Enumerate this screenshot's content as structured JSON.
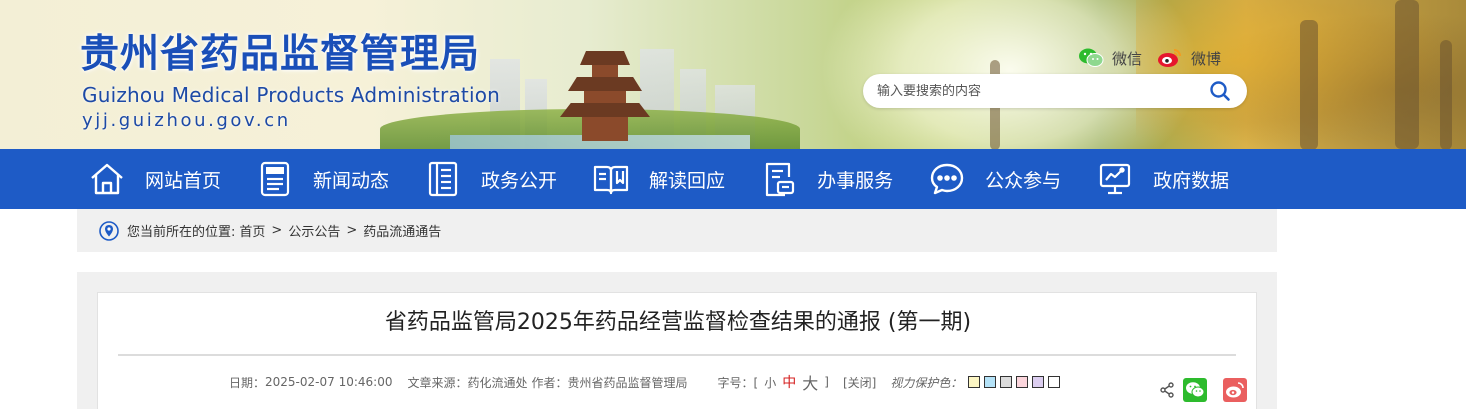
{
  "header": {
    "title": "贵州省药品监督管理局",
    "subtitle_en": "Guizhou Medical Products Administration",
    "domain": "yjj.guizhou.gov.cn",
    "wechat_label": "微信",
    "weibo_label": "微博",
    "search_placeholder": "输入要搜索的内容",
    "search_value": ""
  },
  "nav": {
    "items": [
      {
        "label": "网站首页",
        "icon": "home-icon"
      },
      {
        "label": "新闻动态",
        "icon": "news-icon"
      },
      {
        "label": "政务公开",
        "icon": "document-list-icon"
      },
      {
        "label": "解读回应",
        "icon": "open-book-icon"
      },
      {
        "label": "办事服务",
        "icon": "service-form-icon"
      },
      {
        "label": "公众参与",
        "icon": "chat-bubble-icon"
      },
      {
        "label": "政府数据",
        "icon": "data-monitor-icon"
      }
    ]
  },
  "breadcrumb": {
    "prefix": "您当前所在的位置:",
    "items": [
      "首页",
      "公示公告",
      "药品流通通告"
    ],
    "separator": ">"
  },
  "article": {
    "title": "省药品监管局2025年药品经营监督检查结果的通报 (第一期)",
    "date_label": "日期：",
    "date_value": "2025-02-07 10:46:00",
    "source_label": "文章来源：",
    "source_value": "药化流通处",
    "author_label": "作者：",
    "author_value": "贵州省药品监督管理局",
    "font_size_label": "字号：[",
    "font_size_close_bracket": "]",
    "font_small": "小",
    "font_medium": "中",
    "font_large": "大",
    "close_label": "[关闭]",
    "eye_care_label": "视力保护色：",
    "eye_care_colors": [
      "#fcf6c4",
      "#b4e2f7",
      "#dcdcdc",
      "#fbd5dc",
      "#dccef0",
      "#ffffff"
    ]
  },
  "colors": {
    "nav_bg": "#1e5bc6",
    "title_blue": "#1a4fb8",
    "wechat_green": "#2dbb2d",
    "weibo_red": "#ea5f5f",
    "active_font_red": "#d41f1f"
  }
}
